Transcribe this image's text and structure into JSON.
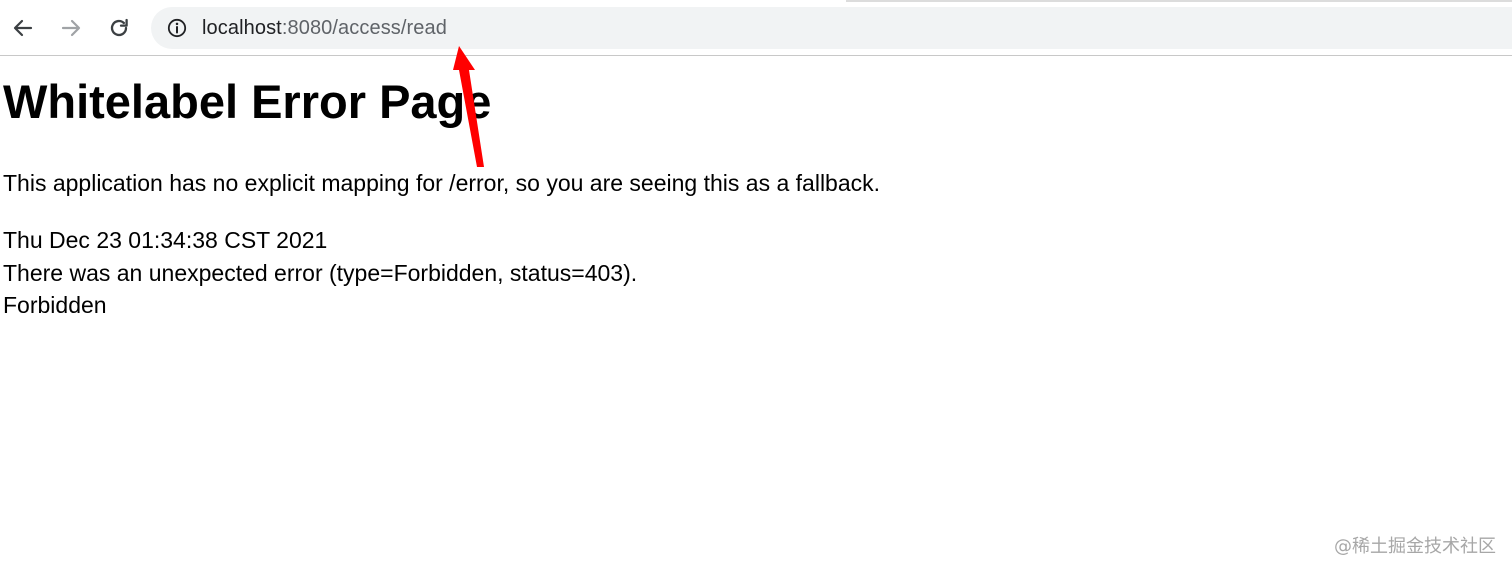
{
  "browser": {
    "url_host": "localhost",
    "url_path": ":8080/access/read",
    "icons": {
      "back": "arrow-left-icon",
      "forward": "arrow-right-icon",
      "reload": "reload-icon",
      "site_info": "info-icon"
    }
  },
  "page": {
    "title": "Whitelabel Error Page",
    "fallback_message": "This application has no explicit mapping for /error, so you are seeing this as a fallback.",
    "timestamp": "Thu Dec 23 01:34:38 CST 2021",
    "error_detail": "There was an unexpected error (type=Forbidden, status=403).",
    "error_message": "Forbidden"
  },
  "annotation": {
    "color": "#ff0000"
  },
  "watermark": {
    "text": "@稀土掘金技术社区"
  }
}
